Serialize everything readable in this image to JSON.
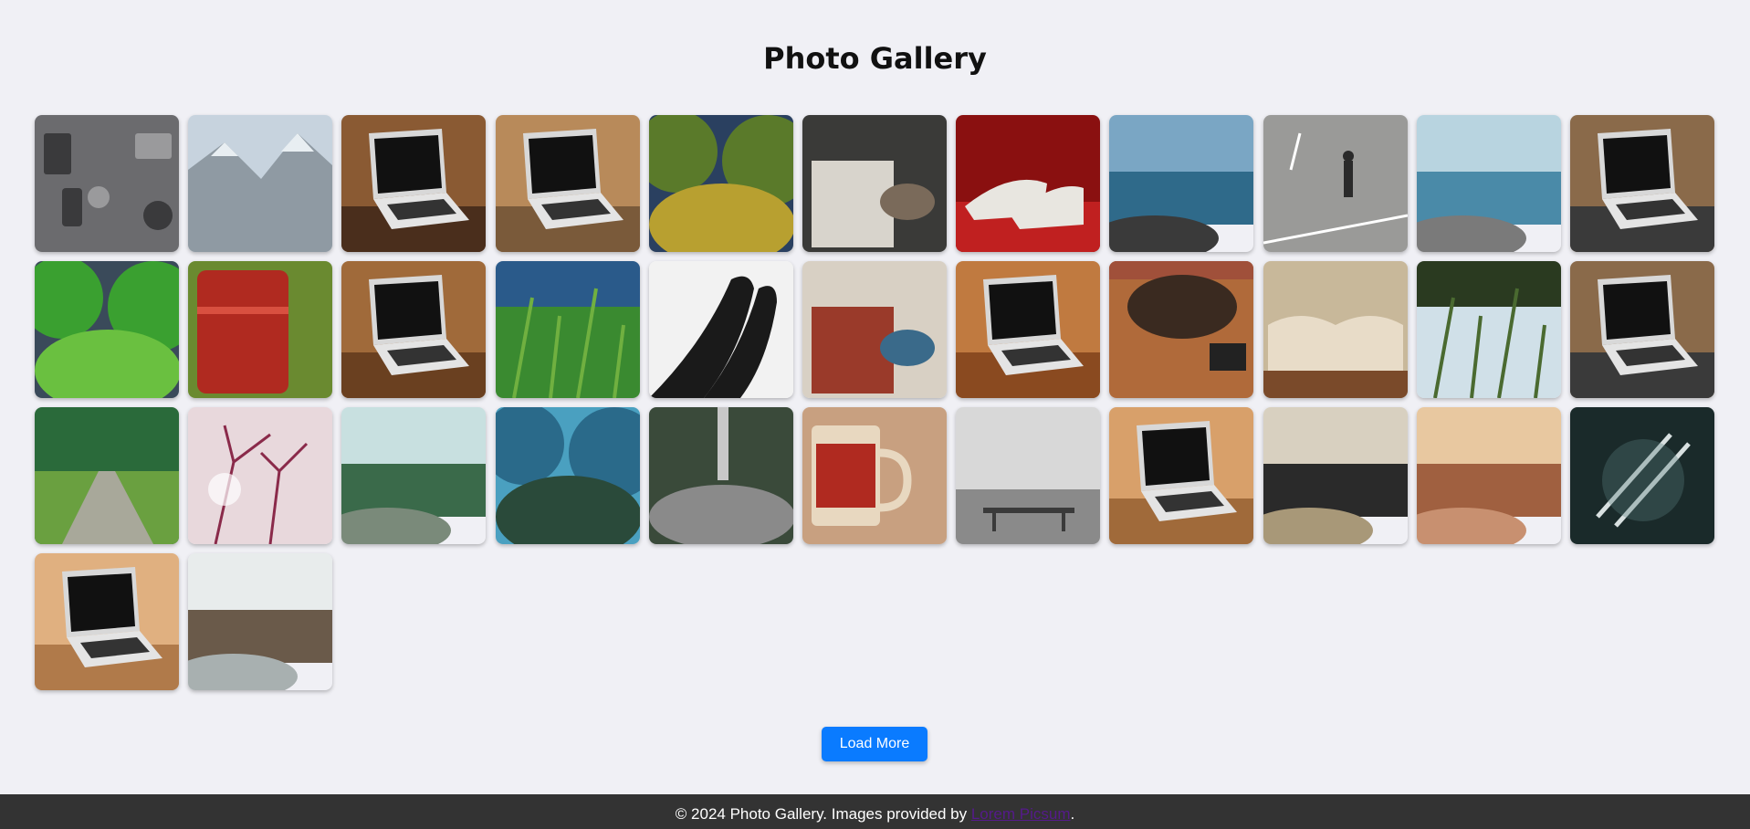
{
  "page": {
    "title": "Photo Gallery"
  },
  "gallery": {
    "photos": [
      {
        "subject": "flat lay of gadgets and accessories",
        "colors": [
          "#6b6b6e",
          "#3a3a3c",
          "#9a9a9c"
        ],
        "icon": "gadgets"
      },
      {
        "subject": "snowy mountain range",
        "colors": [
          "#c7d3de",
          "#8f9aa3",
          "#e8eef2"
        ],
        "icon": "mountain"
      },
      {
        "subject": "laptop on wooden table",
        "colors": [
          "#4a2e1c",
          "#8a5a33",
          "#2a1a10"
        ],
        "icon": "laptop"
      },
      {
        "subject": "hand holding phone over laptop",
        "colors": [
          "#7a5a3a",
          "#b88a5a",
          "#3a2a1e"
        ],
        "icon": "laptop"
      },
      {
        "subject": "mossy tree trunk",
        "colors": [
          "#5a7a2a",
          "#b8a030",
          "#2a4060"
        ],
        "icon": "tree"
      },
      {
        "subject": "person writing in notebook",
        "colors": [
          "#3a3a38",
          "#d8d4cc",
          "#7a6a5a"
        ],
        "icon": "notebook"
      },
      {
        "subject": "white high heels on red floor",
        "colors": [
          "#8a1010",
          "#c02020",
          "#e8e6e0"
        ],
        "icon": "shoes"
      },
      {
        "subject": "sea with rocky shore",
        "colors": [
          "#7aa6c4",
          "#2f6a8a",
          "#3a3a3a"
        ],
        "icon": "sea"
      },
      {
        "subject": "person walking on asphalt",
        "colors": [
          "#9a9a98",
          "#7a7a78",
          "#2a2a2a"
        ],
        "icon": "road"
      },
      {
        "subject": "pebble beach with forest",
        "colors": [
          "#b8d4e0",
          "#4a8aa8",
          "#7a7a7a"
        ],
        "icon": "sea"
      },
      {
        "subject": "person typing on laptop",
        "colors": [
          "#3a3a3a",
          "#8a6a4a",
          "#cfcfcf"
        ],
        "icon": "laptop"
      },
      {
        "subject": "green valley with stream",
        "colors": [
          "#3aa030",
          "#6ac040",
          "#3a4a5a"
        ],
        "icon": "tree"
      },
      {
        "subject": "red rusty barrel in grass",
        "colors": [
          "#b02a20",
          "#6a8a30",
          "#d85040"
        ],
        "icon": "barrel"
      },
      {
        "subject": "laptop with coffee cup",
        "colors": [
          "#6a4020",
          "#a06a3a",
          "#2a1a10"
        ],
        "icon": "laptop"
      },
      {
        "subject": "tall grass with trees",
        "colors": [
          "#3a8a30",
          "#70b040",
          "#2a5a8a"
        ],
        "icon": "grass"
      },
      {
        "subject": "black and white feet",
        "colors": [
          "#f2f2f2",
          "#1a1a1a",
          "#8a8a8a"
        ],
        "icon": "feet"
      },
      {
        "subject": "desk with books and phone",
        "colors": [
          "#d8d0c4",
          "#9a3a2a",
          "#3a6a8a"
        ],
        "icon": "notebook"
      },
      {
        "subject": "laptop on cafe table",
        "colors": [
          "#8a4a20",
          "#c07a40",
          "#e8e0d0"
        ],
        "icon": "laptop"
      },
      {
        "subject": "bag and tablet on table",
        "colors": [
          "#6a3a20",
          "#b06a3a",
          "#3a2a20"
        ],
        "icon": "bag"
      },
      {
        "subject": "open book",
        "colors": [
          "#e8dcc8",
          "#7a4a2a",
          "#c8b89a"
        ],
        "icon": "book"
      },
      {
        "subject": "meadow at sunset",
        "colors": [
          "#d0e0e8",
          "#4a6a30",
          "#2a3a20"
        ],
        "icon": "grass"
      },
      {
        "subject": "person using laptop",
        "colors": [
          "#3a3a3a",
          "#8a6a4a",
          "#5a6a7a"
        ],
        "icon": "laptop"
      },
      {
        "subject": "forest path",
        "colors": [
          "#2a6a3a",
          "#6aa040",
          "#a8a89a"
        ],
        "icon": "path"
      },
      {
        "subject": "pink blossoms",
        "colors": [
          "#e8d8dc",
          "#8a2a4a",
          "#f4eaec"
        ],
        "icon": "blossom"
      },
      {
        "subject": "misty river valley",
        "colors": [
          "#c8e0e0",
          "#3a6a4a",
          "#7a8a7a"
        ],
        "icon": "sea"
      },
      {
        "subject": "pine trees and sea",
        "colors": [
          "#2a6a8a",
          "#2a4a3a",
          "#4aa0c0"
        ],
        "icon": "tree"
      },
      {
        "subject": "waterfall over rocks",
        "colors": [
          "#3a4a3a",
          "#8a8a8a",
          "#c8c8c8"
        ],
        "icon": "waterfall"
      },
      {
        "subject": "red coffee mug",
        "colors": [
          "#c8a080",
          "#b02a20",
          "#e8d8c0"
        ],
        "icon": "mug"
      },
      {
        "subject": "bench by white wall",
        "colors": [
          "#d8d8d8",
          "#8a8a8a",
          "#3a3a3a"
        ],
        "icon": "bench"
      },
      {
        "subject": "laptop on wood",
        "colors": [
          "#a06a3a",
          "#d8a06a",
          "#2a2a2a"
        ],
        "icon": "laptop"
      },
      {
        "subject": "rocky beach",
        "colors": [
          "#d8d0c0",
          "#2a2a2a",
          "#a89878"
        ],
        "icon": "sea"
      },
      {
        "subject": "sandy coast aerial",
        "colors": [
          "#e8c8a0",
          "#a06040",
          "#c89070"
        ],
        "icon": "sea"
      },
      {
        "subject": "crossed forks",
        "colors": [
          "#1a2a2a",
          "#5a7a7a",
          "#d8e0e0"
        ],
        "icon": "forks"
      },
      {
        "subject": "laptop with phone and coffee",
        "colors": [
          "#b07a4a",
          "#e0b080",
          "#2a2a2a"
        ],
        "icon": "laptop"
      },
      {
        "subject": "rocky shore and calm water",
        "colors": [
          "#e8ecec",
          "#6a5a4a",
          "#a8b0b0"
        ],
        "icon": "sea"
      }
    ]
  },
  "load_more": {
    "label": "Load More"
  },
  "footer": {
    "text_prefix": "© 2024 Photo Gallery. Images provided by ",
    "link_label": "Lorem Picsum",
    "text_suffix": "."
  }
}
